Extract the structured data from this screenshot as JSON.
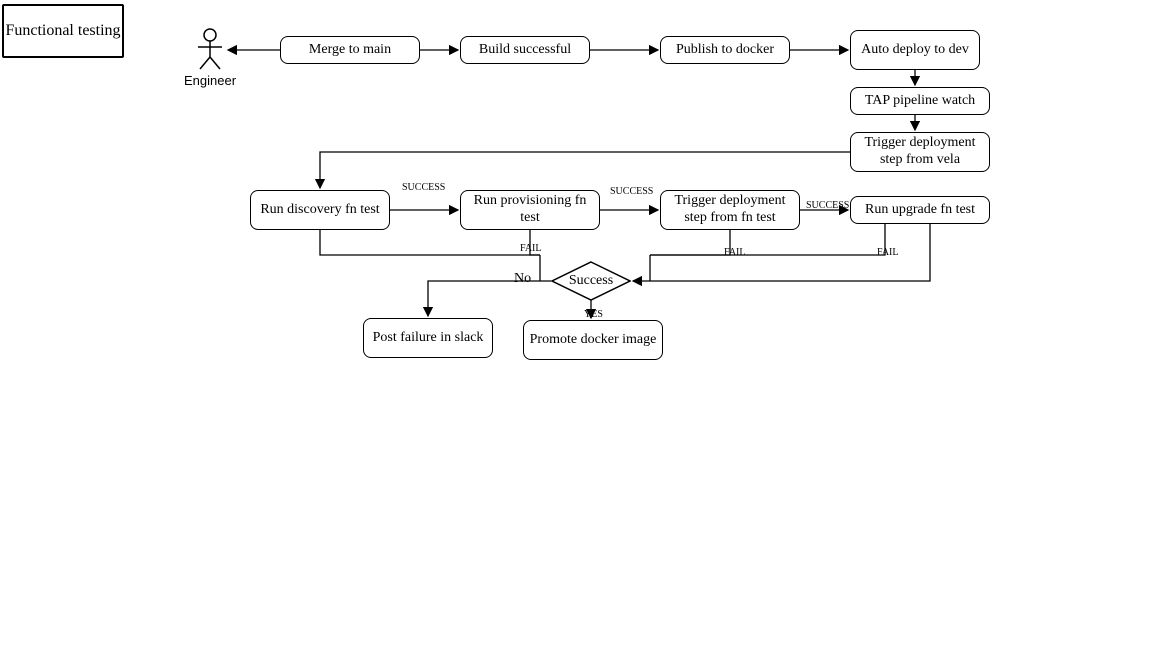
{
  "title": "Functional testing",
  "actor": {
    "label": "Engineer"
  },
  "nodes": {
    "merge": "Merge to main",
    "build": "Build successful",
    "publish": "Publish to docker",
    "autodeploy": "Auto deploy to dev",
    "tapwatch": "TAP pipeline watch",
    "triggerVela": "Trigger deployment step from vela",
    "discovery": "Run discovery fn test",
    "provisioning": "Run provisioning fn test",
    "triggerFn": "Trigger deployment step from fn test",
    "upgrade": "Run upgrade fn test",
    "success": "Success",
    "postFailure": "Post failure in slack",
    "promote": "Promote docker image"
  },
  "labels": {
    "success1": "SUCCESS",
    "success2": "SUCCESS",
    "success3": "SUCCESS",
    "fail1": "FAIL",
    "fail2": "FAIL",
    "fail3": "FAIL",
    "no": "No",
    "yes": "YES"
  }
}
